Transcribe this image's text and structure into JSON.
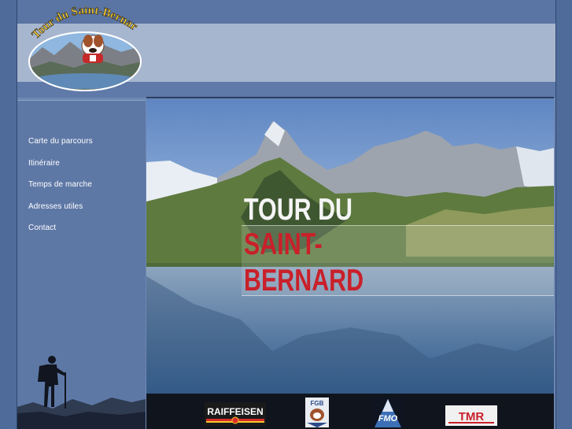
{
  "logo": {
    "text": "Tour du Saint-Bernard"
  },
  "nav": {
    "items": [
      {
        "label": "Carte du parcours"
      },
      {
        "label": "Itinéraire"
      },
      {
        "label": "Temps de marche"
      },
      {
        "label": "Adresses utiles"
      },
      {
        "label": "Contact"
      }
    ]
  },
  "hero": {
    "line1": "TOUR DU",
    "line2": "SAINT-",
    "line3": "BERNARD"
  },
  "sponsors": {
    "raiffeisen": "RAIFFEISEN",
    "fgb": "FGB",
    "fmo": "FMO",
    "tmr": "TMR"
  },
  "colors": {
    "background": "#4f6b99",
    "header_band": "#a7b6cf",
    "sidebar": "#5e78a6",
    "title_white": "#f5f5f5",
    "title_red": "#c9202a",
    "sponsor_bar": "#10141c"
  }
}
